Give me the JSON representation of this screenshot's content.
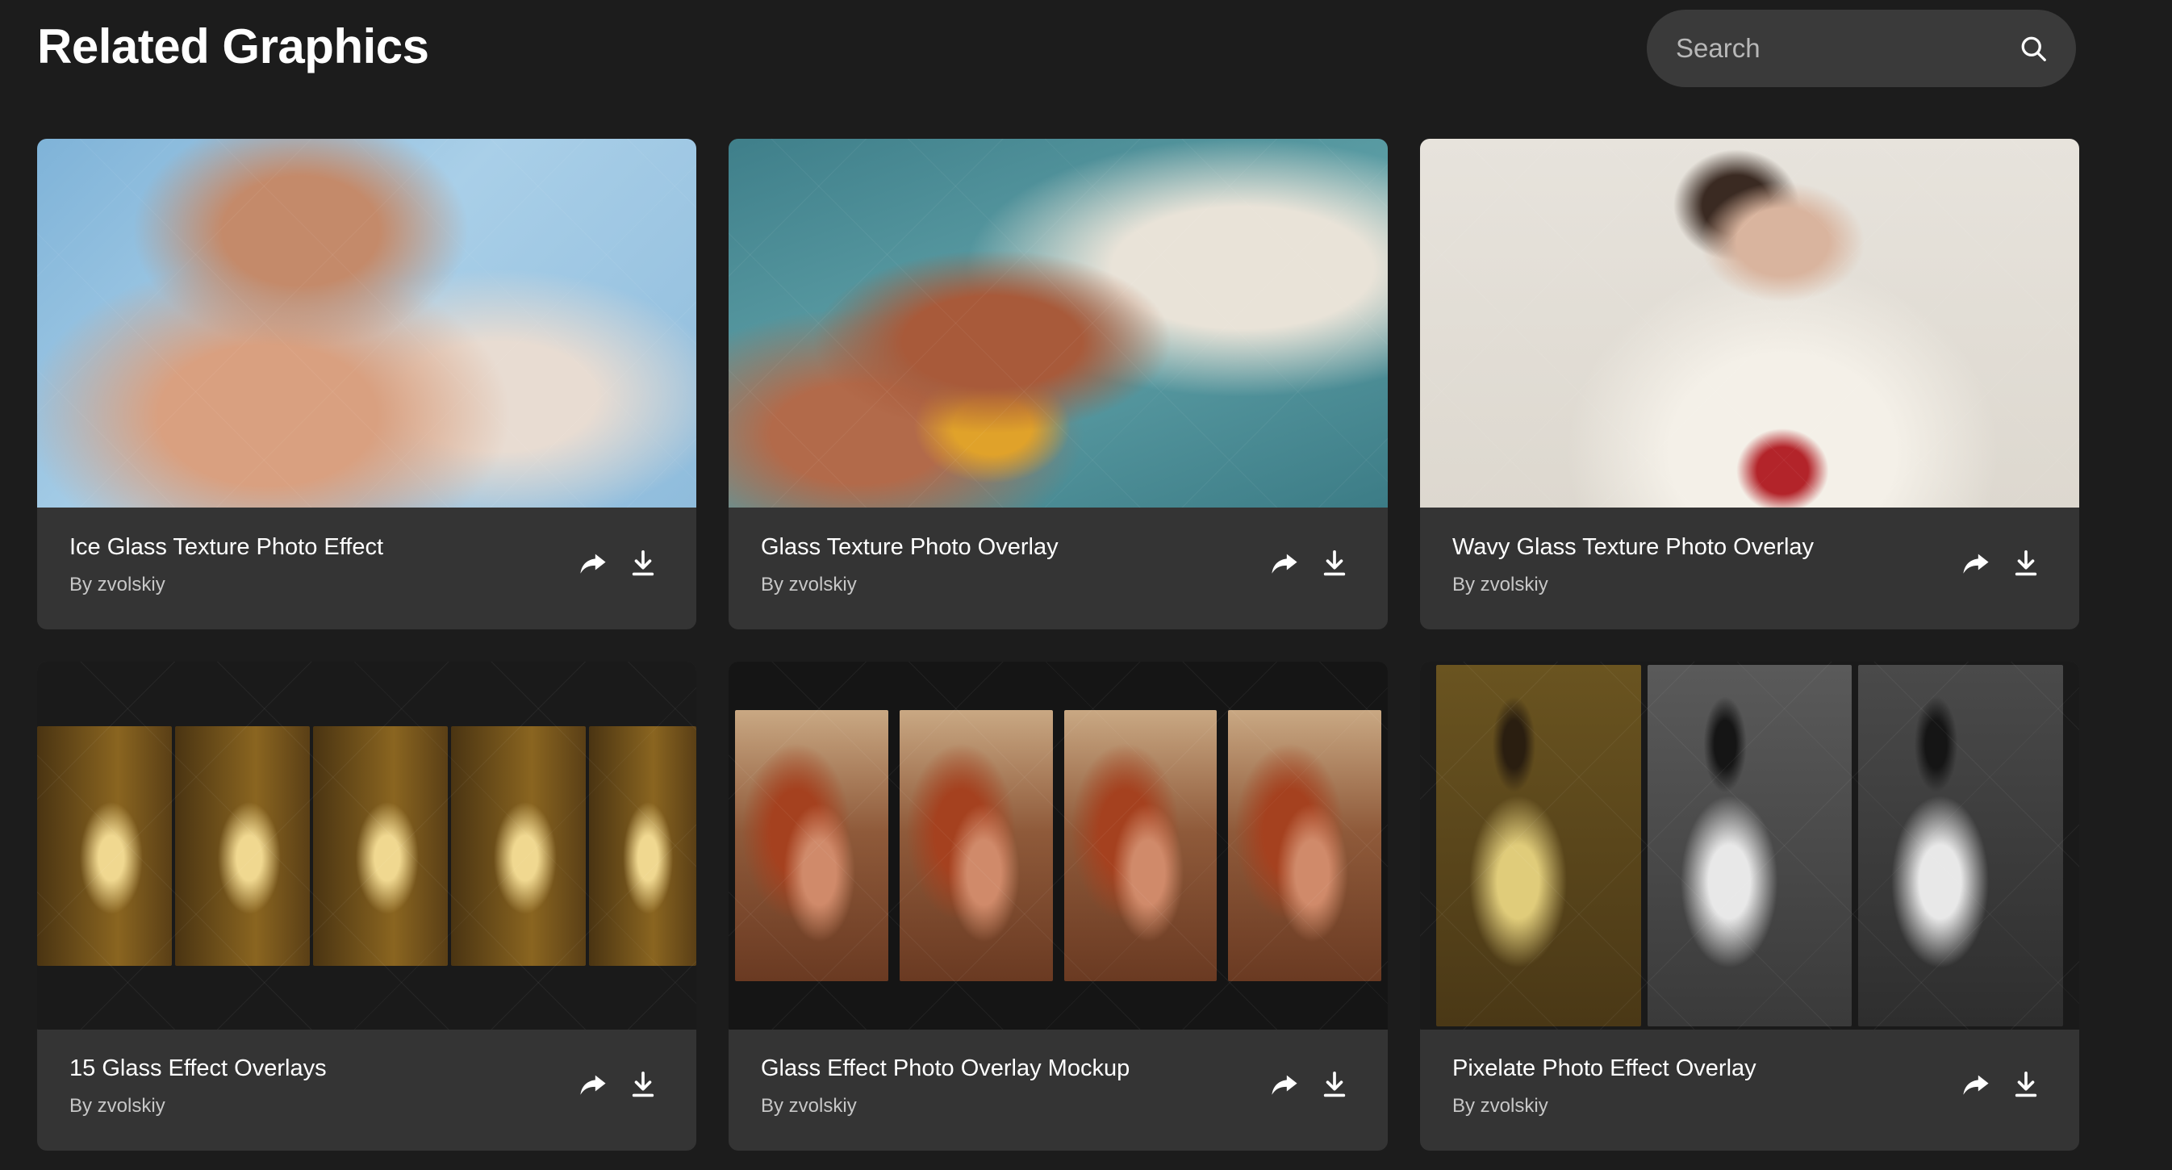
{
  "header": {
    "title": "Related Graphics",
    "search_placeholder": "Search"
  },
  "cards": [
    {
      "title": "Ice Glass Texture Photo Effect",
      "author": "By zvolskiy"
    },
    {
      "title": "Glass Texture Photo Overlay",
      "author": "By zvolskiy"
    },
    {
      "title": "Wavy Glass Texture Photo Overlay",
      "author": "By zvolskiy"
    },
    {
      "title": "15 Glass Effect Overlays",
      "author": "By zvolskiy"
    },
    {
      "title": "Glass Effect Photo Overlay Mockup",
      "author": "By zvolskiy"
    },
    {
      "title": "Pixelate Photo Effect Overlay",
      "author": "By zvolskiy"
    }
  ],
  "icons": {
    "search": "search-icon",
    "share": "share-icon",
    "download": "download-icon"
  },
  "colors": {
    "background": "#1c1c1c",
    "card": "#343434",
    "search_bg": "#3a3a3a"
  }
}
